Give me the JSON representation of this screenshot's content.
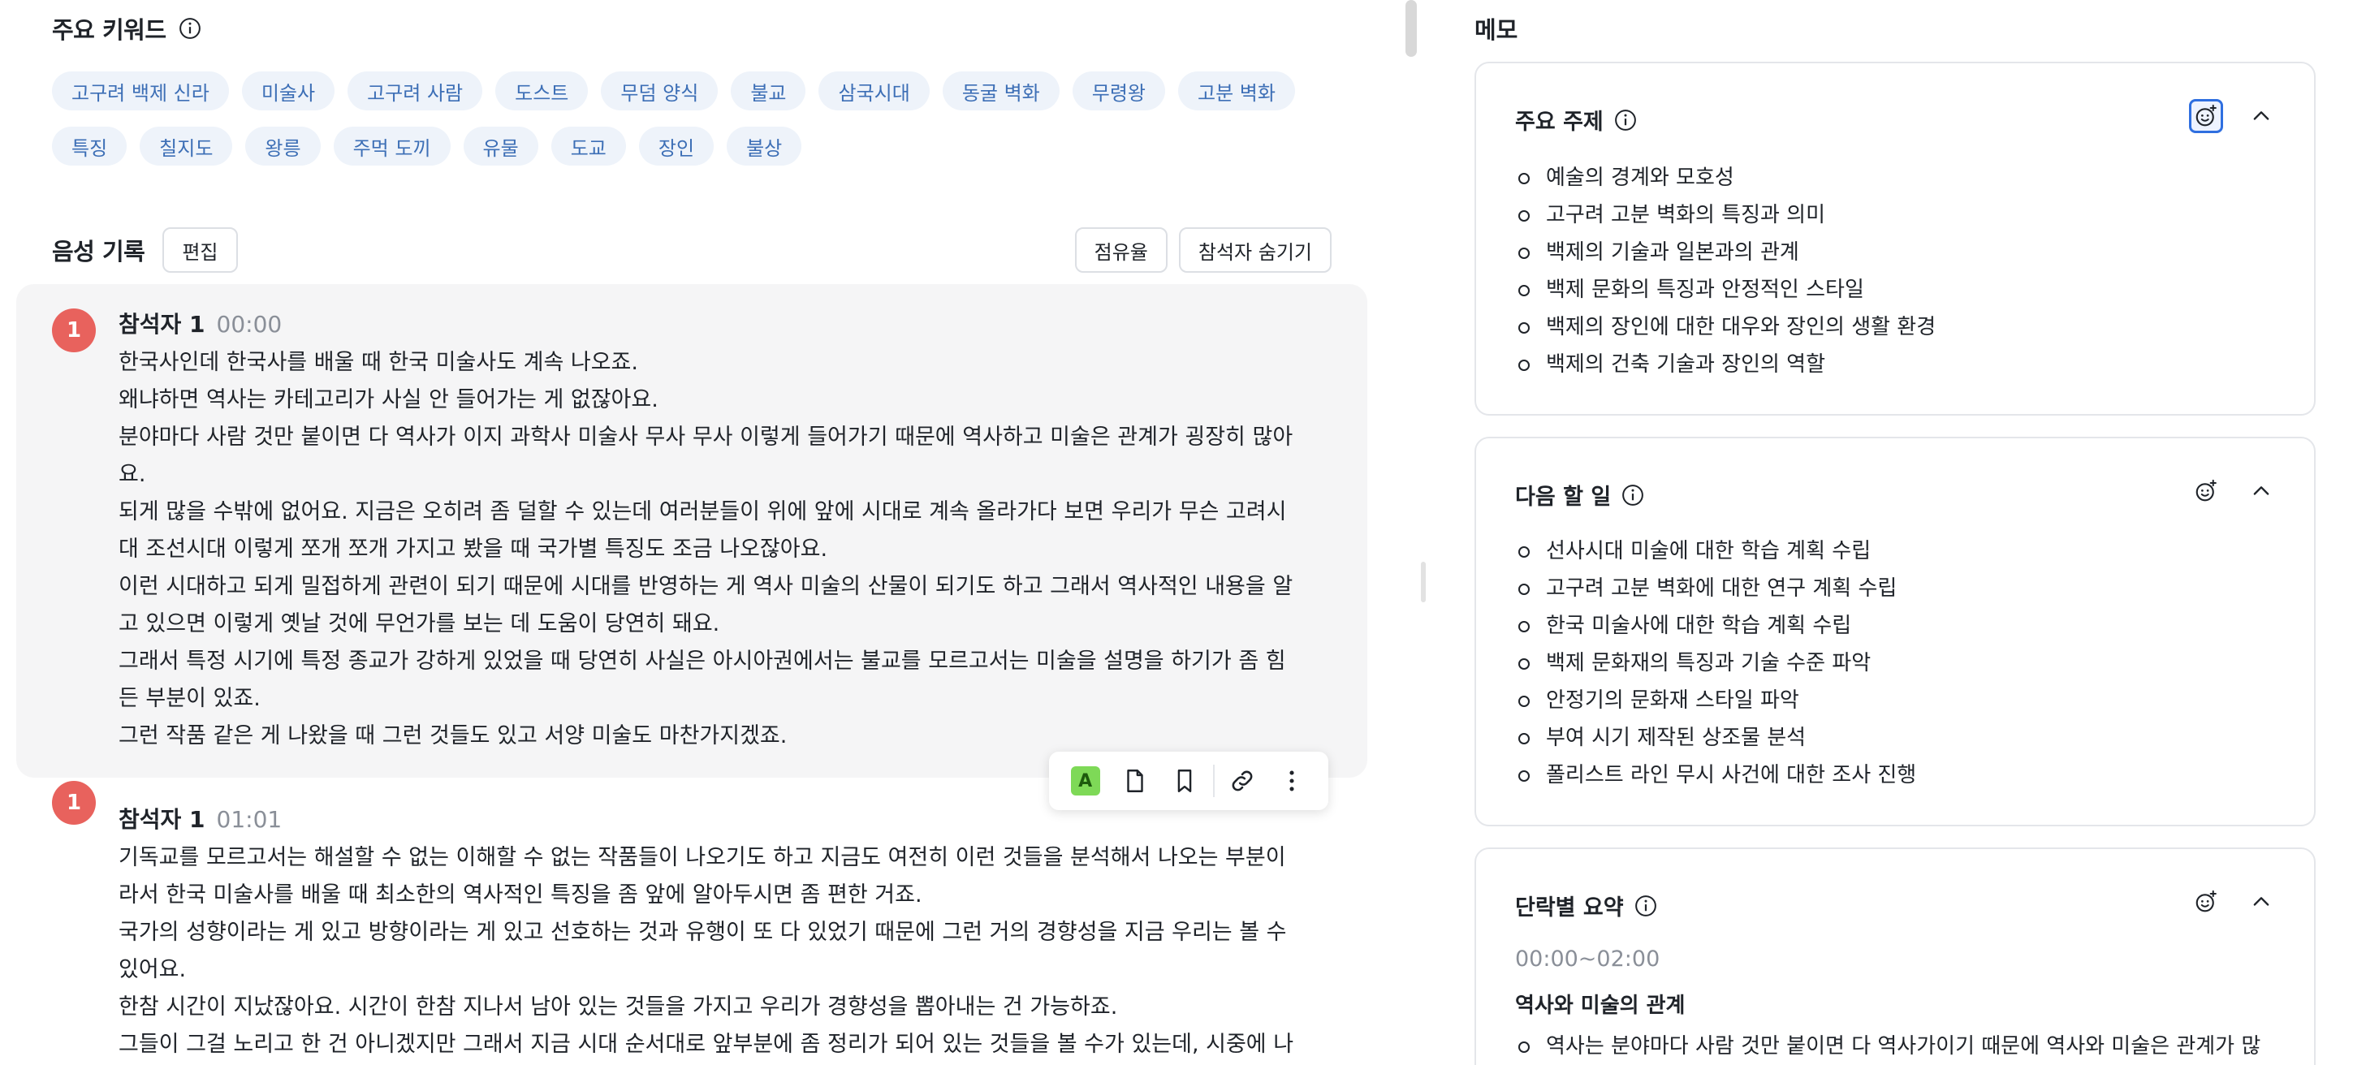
{
  "keywords": {
    "title": "주요 키워드",
    "chips": [
      "고구려 백제 신라",
      "미술사",
      "고구려 사람",
      "도스트",
      "무덤 양식",
      "불교",
      "삼국시대",
      "동굴 벽화",
      "무령왕",
      "고분 벽화",
      "특징",
      "칠지도",
      "왕릉",
      "주먹 도끼",
      "유물",
      "도교",
      "장인",
      "불상"
    ]
  },
  "recording": {
    "title": "음성 기록",
    "edit_label": "편집",
    "share_label": "점유율",
    "hide_participants_label": "참석자 숨기기"
  },
  "utterances": [
    {
      "avatar": "1",
      "speaker": "참석자 1",
      "time": "00:00",
      "lines": [
        "한국사인데 한국사를 배울 때 한국 미술사도 계속 나오죠.",
        "왜냐하면 역사는 카테고리가 사실 안 들어가는 게 없잖아요.",
        "분야마다 사람 것만 붙이면 다 역사가 이지 과학사 미술사 무사 무사 이렇게 들어가기 때문에 역사하고 미술은 관계가 굉장히 많아",
        "요.",
        "되게 많을 수밖에 없어요. 지금은 오히려 좀 덜할 수 있는데 여러분들이 위에 앞에 시대로 계속 올라가다 보면 우리가 무슨 고려시",
        "대 조선시대 이렇게 쪼개 쪼개 가지고 봤을 때 국가별 특징도 조금 나오잖아요.",
        "이런 시대하고 되게 밀접하게 관련이 되기 때문에 시대를 반영하는 게 역사 미술의 산물이 되기도 하고 그래서 역사적인 내용을 알",
        "고 있으면 이렇게 옛날 것에 무언가를 보는 데 도움이 당연히 돼요.",
        "그래서 특정 시기에 특정 종교가 강하게 있었을 때 당연히 사실은 아시아권에서는 불교를 모르고서는 미술을 설명을 하기가 좀 힘",
        "든 부분이 있죠.",
        "그런 작품 같은 게 나왔을 때 그런 것들도 있고 서양 미술도 마찬가지겠죠."
      ]
    },
    {
      "avatar": "1",
      "speaker": "참석자 1",
      "time": "01:01",
      "lines": [
        "기독교를 모르고서는 해설할 수 없는 이해할 수 없는 작품들이 나오기도 하고 지금도 여전히 이런 것들을 분석해서 나오는 부분이",
        "라서 한국 미술사를 배울 때 최소한의 역사적인 특징을 좀 앞에 알아두시면 좀 편한 거죠.",
        "국가의 성향이라는 게 있고 방향이라는 게 있고 선호하는 것과 유행이 또 다 있었기 때문에 그런 거의 경향성을 지금 우리는 볼 수",
        "있어요.",
        "한참 시간이 지났잖아요. 시간이 한참 지나서 남아 있는 것들을 가지고 우리가 경향성을 뽑아내는 건 가능하죠.",
        "그들이 그걸 노리고 한 건 아니겠지만 그래서 지금 시대 순서대로 앞부분에 좀 정리가 되어 있는 것들을 볼 수가 있는데, 시중에 나"
      ]
    }
  ],
  "toolbar": {
    "highlight_label": "A"
  },
  "memo": {
    "title": "메모",
    "topics": {
      "title": "주요 주제",
      "items": [
        "예술의 경계와 모호성",
        "고구려 고분 벽화의 특징과 의미",
        "백제의 기술과 일본과의 관계",
        "백제 문화의 특징과 안정적인 스타일",
        "백제의 장인에 대한 대우와 장인의 생활 환경",
        "백제의 건축 기술과 장인의 역할"
      ]
    },
    "todo": {
      "title": "다음 할 일",
      "items": [
        "선사시대 미술에 대한 학습 계획 수립",
        "고구려 고분 벽화에 대한 연구 계획 수립",
        "한국 미술사에 대한 학습 계획 수립",
        "백제 문화재의 특징과 기술 수준 파악",
        "안정기의 문화재 스타일 파악",
        "부여 시기 제작된 상조물 분석",
        "폴리스트 라인 무시 사건에 대한 조사 진행"
      ]
    },
    "summary": {
      "title": "단락별 요약",
      "time_range": "00:00~02:00",
      "para_title": "역사와 미술의 관계",
      "items": [
        "역사는 분야마다 사람 것만 붙이면 다 역사가이기 때문에 역사와 미술은 관계가 많"
      ]
    }
  },
  "colors": {
    "chip_bg": "#eef3fa",
    "chip_text": "#3d6fb6",
    "avatar": "#e8625d",
    "highlight_badge": "#7ed957",
    "active_ai_icon": "#2f6fe0"
  }
}
